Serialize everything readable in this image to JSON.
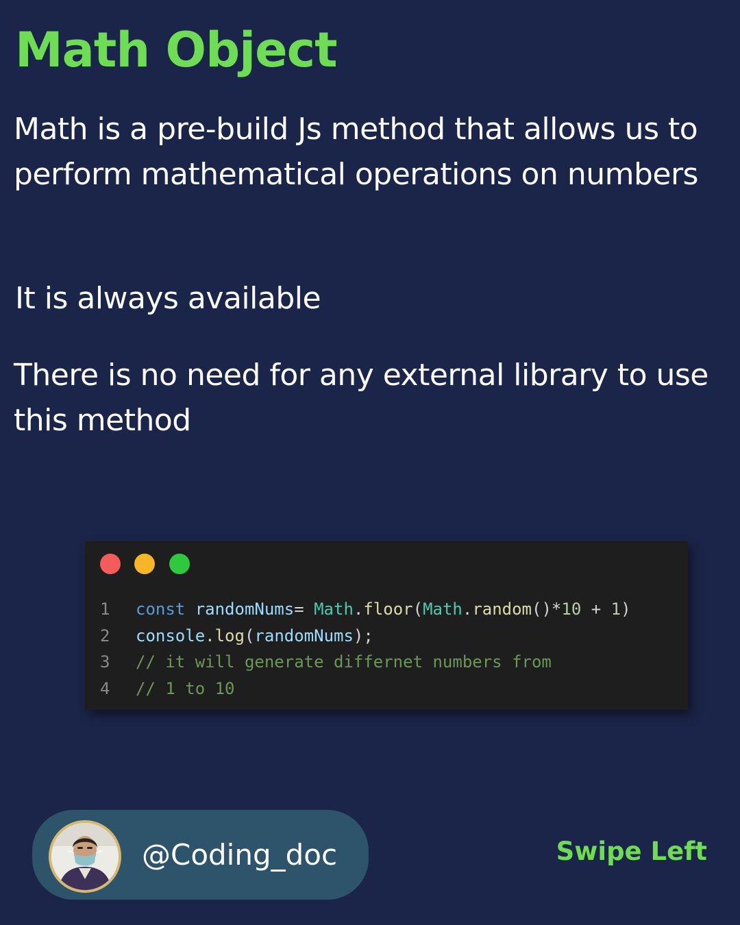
{
  "header": {
    "title": "Math Object"
  },
  "content": {
    "paragraphs": [
      "Math is a pre-build Js method that allows us to perform mathematical operations on numbers",
      "It is always available",
      "There is no need for any external library to use this method"
    ]
  },
  "code": {
    "line_numbers": [
      "1",
      "2",
      "3",
      "4"
    ],
    "line1": {
      "kw": "const",
      "var": "randomNums",
      "eq": "= ",
      "cls1": "Math",
      "dot1": ".",
      "fn1": "floor",
      "p1": "(",
      "cls2": "Math",
      "dot2": ".",
      "fn2": "random",
      "p2": "()*",
      "num1": "10",
      "plus": " + ",
      "num2": "1",
      "p3": ")"
    },
    "line2": {
      "obj": "console",
      "dot": ".",
      "fn": "log",
      "p1": "(",
      "var": "randomNums",
      "p2": ");"
    },
    "line3": "// it will generate differnet numbers from",
    "line4": "// 1 to 10"
  },
  "footer": {
    "handle": "@Coding_doc",
    "swipe": "Swipe Left"
  },
  "colors": {
    "background": "#1b2549",
    "accent_green": "#6fdc56",
    "pill": "#2d546b",
    "code_bg": "#1e1e1e"
  }
}
